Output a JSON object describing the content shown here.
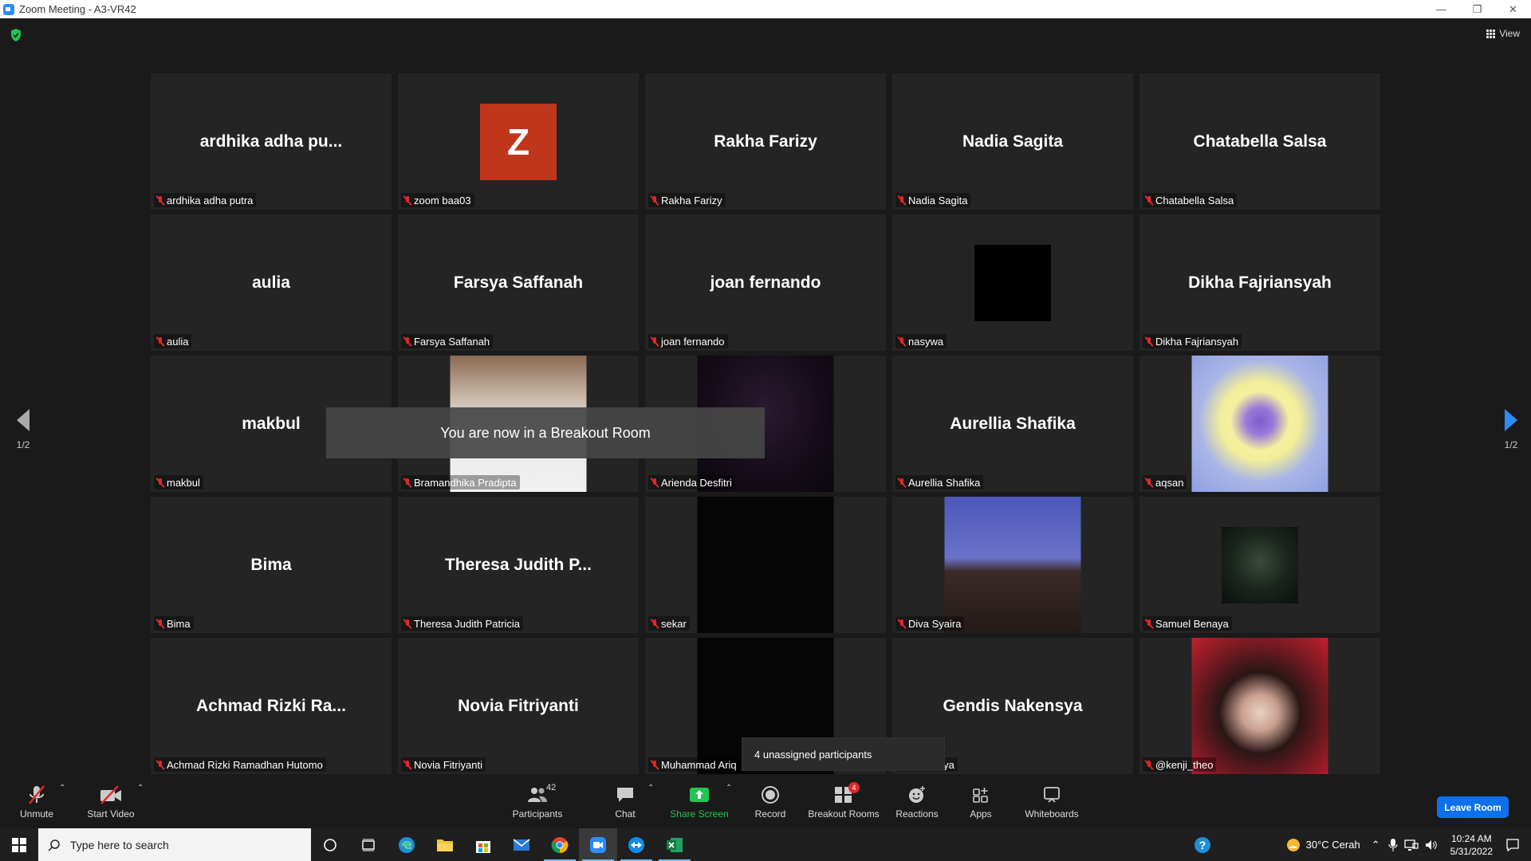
{
  "window": {
    "title": "Zoom Meeting - A3-VR42",
    "controls": [
      "—",
      "❐",
      "✕"
    ]
  },
  "view_label": "View",
  "page_indicator_left": "1/2",
  "page_indicator_right": "1/2",
  "toast": "You are now in a Breakout Room",
  "tooltip": "4 unassigned participants",
  "tiles": [
    {
      "name": "ardhika adha pu...",
      "label": "ardhika adha putra",
      "type": "name"
    },
    {
      "avatar_letter": "Z",
      "label": "zoom baa03",
      "type": "avatar",
      "avatar_color": "#c0361a"
    },
    {
      "name": "Rakha Farizy",
      "label": "Rakha Farizy",
      "type": "name"
    },
    {
      "name": "Nadia Sagita",
      "label": "Nadia Sagita",
      "type": "name"
    },
    {
      "name": "Chatabella Salsa",
      "label": "Chatabella Salsa",
      "type": "name"
    },
    {
      "name": "aulia",
      "label": "aulia",
      "type": "name"
    },
    {
      "name": "Farsya Saffanah",
      "label": "Farsya Saffanah",
      "type": "name"
    },
    {
      "name": "joan fernando",
      "label": "joan fernando",
      "type": "name"
    },
    {
      "label": "nasywa",
      "type": "black-square"
    },
    {
      "name": "Dikha Fajriansyah",
      "label": "Dikha Fajriansyah",
      "type": "name"
    },
    {
      "name": "makbul",
      "label": "makbul",
      "type": "name"
    },
    {
      "label": "Bramandhika Pradipta",
      "type": "photo-cat"
    },
    {
      "label": "Arienda Desfitri",
      "type": "photo-dark-purple"
    },
    {
      "name": "Aurellia Shafika",
      "label": "Aurellia Shafika",
      "type": "name"
    },
    {
      "label": "aqsan",
      "type": "photo-heart"
    },
    {
      "name": "Bima",
      "label": "Bima",
      "type": "name"
    },
    {
      "name": "Theresa Judith P...",
      "label": "Theresa Judith Patricia",
      "type": "name"
    },
    {
      "label": "sekar",
      "type": "photo-black"
    },
    {
      "label": "Diva Syaira",
      "type": "photo-sky"
    },
    {
      "label": "Samuel Benaya",
      "type": "photo-person-small"
    },
    {
      "name": "Achmad Rizki Ra...",
      "label": "Achmad Rizki Ramadhan Hutomo",
      "type": "name"
    },
    {
      "name": "Novia Fitriyanti",
      "label": "Novia Fitriyanti",
      "type": "name"
    },
    {
      "label": "Muhammad Ariq",
      "type": "photo-black"
    },
    {
      "name": "Gendis Nakensya",
      "label": "Nakensya",
      "type": "name"
    },
    {
      "label": "@kenji_theo",
      "type": "photo-red"
    }
  ],
  "toolbar": {
    "unmute": "Unmute",
    "start_video": "Start Video",
    "participants": "Participants",
    "participants_count": "42",
    "chat": "Chat",
    "share_screen": "Share Screen",
    "record": "Record",
    "breakout_rooms": "Breakout Rooms",
    "breakout_badge": "4",
    "reactions": "Reactions",
    "apps": "Apps",
    "whiteboards": "Whiteboards",
    "leave_room": "Leave Room"
  },
  "taskbar": {
    "search_placeholder": "Type here to search",
    "weather": "30°C  Cerah",
    "time": "10:24 AM",
    "date": "5/31/2022"
  },
  "colors": {
    "accent_blue": "#0e71eb",
    "share_green": "#23c552",
    "muted_red": "#e02828"
  }
}
